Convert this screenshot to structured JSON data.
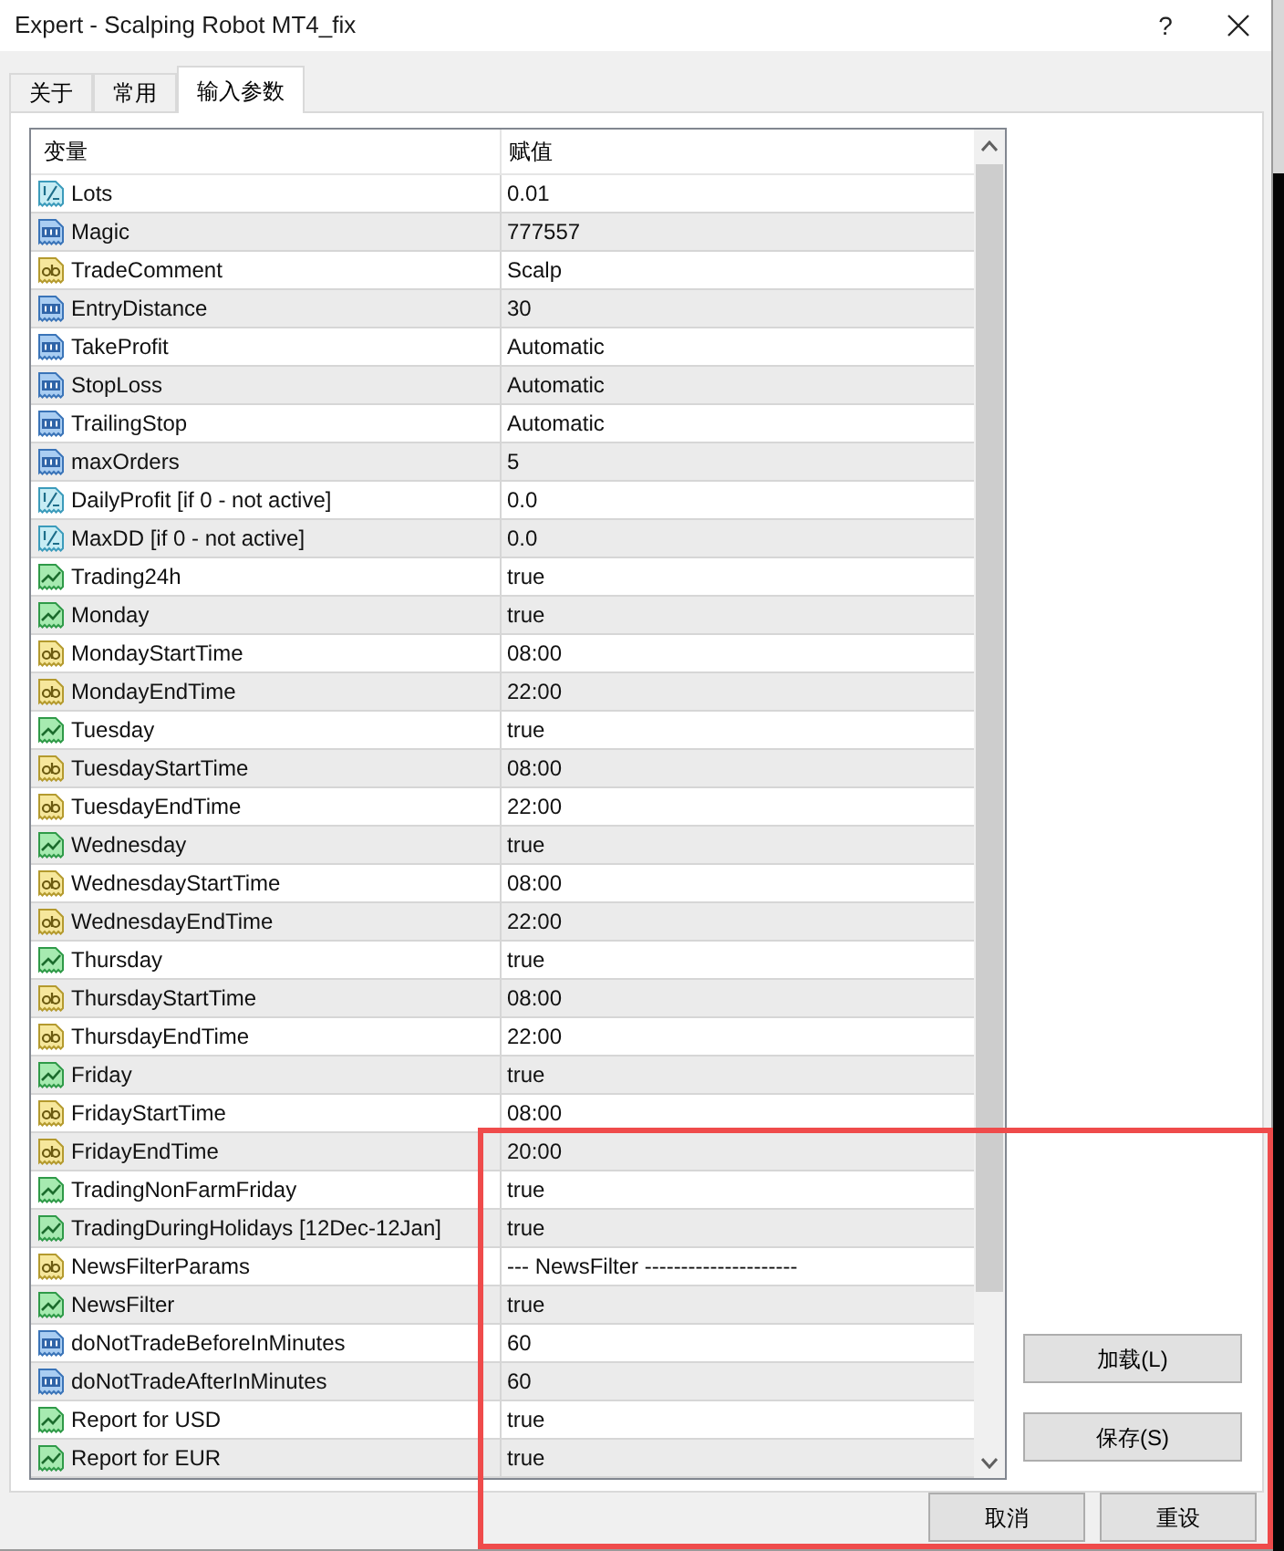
{
  "window": {
    "title": "Expert - Scalping Robot MT4_fix",
    "help_button": "?"
  },
  "tabs": [
    {
      "label": "关于",
      "selected": false
    },
    {
      "label": "常用",
      "selected": false
    },
    {
      "label": "输入参数",
      "selected": true
    }
  ],
  "table": {
    "columns": [
      "变量",
      "赋值"
    ],
    "rows": [
      {
        "kind": "double",
        "name": "Lots",
        "value": "0.01"
      },
      {
        "kind": "int",
        "name": "Magic",
        "value": "777557"
      },
      {
        "kind": "string",
        "name": "TradeComment",
        "value": "Scalp"
      },
      {
        "kind": "int",
        "name": "EntryDistance",
        "value": "30"
      },
      {
        "kind": "int",
        "name": "TakeProfit",
        "value": "Automatic"
      },
      {
        "kind": "int",
        "name": "StopLoss",
        "value": "Automatic"
      },
      {
        "kind": "int",
        "name": "TrailingStop",
        "value": "Automatic"
      },
      {
        "kind": "int",
        "name": "maxOrders",
        "value": "5"
      },
      {
        "kind": "double",
        "name": "DailyProfit [if 0 - not active]",
        "value": "0.0"
      },
      {
        "kind": "double",
        "name": "MaxDD [if 0 - not active]",
        "value": "0.0"
      },
      {
        "kind": "bool",
        "name": "Trading24h",
        "value": "true"
      },
      {
        "kind": "bool",
        "name": "Monday",
        "value": "true"
      },
      {
        "kind": "string",
        "name": "MondayStartTime",
        "value": "08:00"
      },
      {
        "kind": "string",
        "name": "MondayEndTime",
        "value": "22:00"
      },
      {
        "kind": "bool",
        "name": "Tuesday",
        "value": "true"
      },
      {
        "kind": "string",
        "name": "TuesdayStartTime",
        "value": "08:00"
      },
      {
        "kind": "string",
        "name": "TuesdayEndTime",
        "value": "22:00"
      },
      {
        "kind": "bool",
        "name": "Wednesday",
        "value": "true"
      },
      {
        "kind": "string",
        "name": "WednesdayStartTime",
        "value": "08:00"
      },
      {
        "kind": "string",
        "name": "WednesdayEndTime",
        "value": "22:00"
      },
      {
        "kind": "bool",
        "name": "Thursday",
        "value": "true"
      },
      {
        "kind": "string",
        "name": "ThursdayStartTime",
        "value": "08:00"
      },
      {
        "kind": "string",
        "name": "ThursdayEndTime",
        "value": "22:00"
      },
      {
        "kind": "bool",
        "name": "Friday",
        "value": "true"
      },
      {
        "kind": "string",
        "name": "FridayStartTime",
        "value": "08:00"
      },
      {
        "kind": "string",
        "name": "FridayEndTime",
        "value": "20:00"
      },
      {
        "kind": "bool",
        "name": "TradingNonFarmFriday",
        "value": "true"
      },
      {
        "kind": "bool",
        "name": "TradingDuringHolidays [12Dec-12Jan]",
        "value": "true"
      },
      {
        "kind": "string",
        "name": "NewsFilterParams",
        "value": "--- NewsFilter ---------------------"
      },
      {
        "kind": "bool",
        "name": "NewsFilter",
        "value": "true"
      },
      {
        "kind": "int",
        "name": "doNotTradeBeforeInMinutes",
        "value": "60"
      },
      {
        "kind": "int",
        "name": "doNotTradeAfterInMinutes",
        "value": "60"
      },
      {
        "kind": "bool",
        "name": "Report for USD",
        "value": "true"
      },
      {
        "kind": "bool",
        "name": "Report for EUR",
        "value": "true"
      }
    ]
  },
  "side_buttons": [
    "加载(L)",
    "保存(S)"
  ],
  "footer_buttons": [
    "取消",
    "重设"
  ],
  "annotations": [
    {
      "kind": "rectangle"
    }
  ]
}
